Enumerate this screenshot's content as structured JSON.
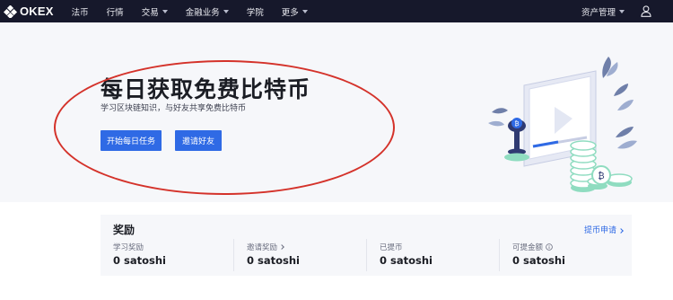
{
  "brand": {
    "logo_text": "OKEX"
  },
  "nav": {
    "items": [
      {
        "label": "法币",
        "dropdown": false
      },
      {
        "label": "行情",
        "dropdown": false
      },
      {
        "label": "交易",
        "dropdown": true
      },
      {
        "label": "金融业务",
        "dropdown": true
      },
      {
        "label": "学院",
        "dropdown": false
      },
      {
        "label": "更多",
        "dropdown": true
      }
    ],
    "asset_management": "资产管理",
    "user_icon": "user-icon"
  },
  "hero": {
    "title": "每日获取免费比特币",
    "subtitle": "学习区块链知识，与好友共享免费比特币",
    "primary_button": "开始每日任务",
    "secondary_button": "邀请好友"
  },
  "rewards": {
    "title": "奖励",
    "link_label": "提币申请",
    "stats": [
      {
        "label": "学习奖励",
        "value": "0 satoshi"
      },
      {
        "label": "邀请奖励",
        "value": "0 satoshi"
      },
      {
        "label": "已提币",
        "value": "0 satoshi"
      },
      {
        "label": "可提金额",
        "value": "0 satoshi"
      }
    ]
  },
  "colors": {
    "nav_bg": "#16182b",
    "accent": "#2f6ae5",
    "annotation": "#d4322a",
    "hero_bg": "#f6f7fa"
  }
}
